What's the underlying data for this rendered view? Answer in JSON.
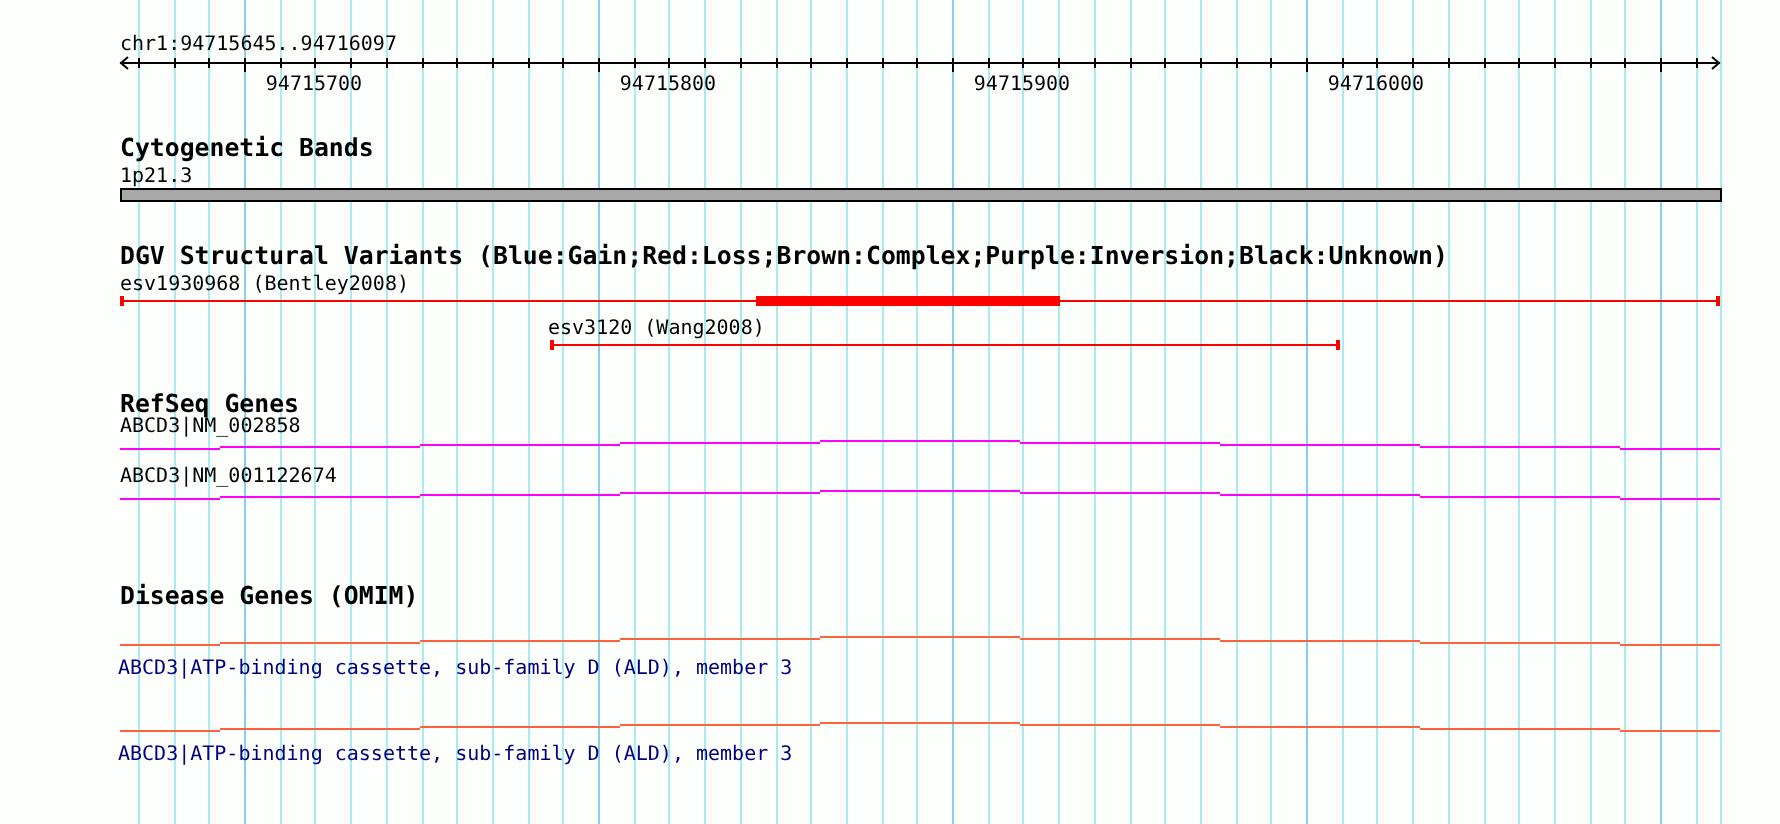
{
  "ruler": {
    "region": "chr1:94715645..94716097",
    "ticks": [
      "94715700",
      "94715800",
      "94715900",
      "94716000"
    ]
  },
  "tracks": [
    {
      "kind": "cytoband",
      "title": "Cytogenetic Bands",
      "features": [
        {
          "label": "1p21.3"
        }
      ]
    },
    {
      "kind": "variant",
      "title": "DGV Structural Variants (Blue:Gain;Red:Loss;Brown:Complex;Purple:Inversion;Black:Unknown)",
      "features": [
        {
          "label": "esv1930968 (Bentley2008)"
        },
        {
          "label": "esv3120 (Wang2008)"
        }
      ]
    },
    {
      "kind": "gene",
      "title": "RefSeq Genes",
      "features": [
        {
          "label": "ABCD3|NM_002858"
        },
        {
          "label": "ABCD3|NM_001122674"
        }
      ]
    },
    {
      "kind": "disease",
      "title": "Disease Genes (OMIM)",
      "features": [
        {
          "label": "ABCD3|ATP-binding cassette, sub-family D (ALD), member 3"
        },
        {
          "label": "ABCD3|ATP-binding cassette, sub-family D (ALD), member 3"
        }
      ]
    }
  ]
}
